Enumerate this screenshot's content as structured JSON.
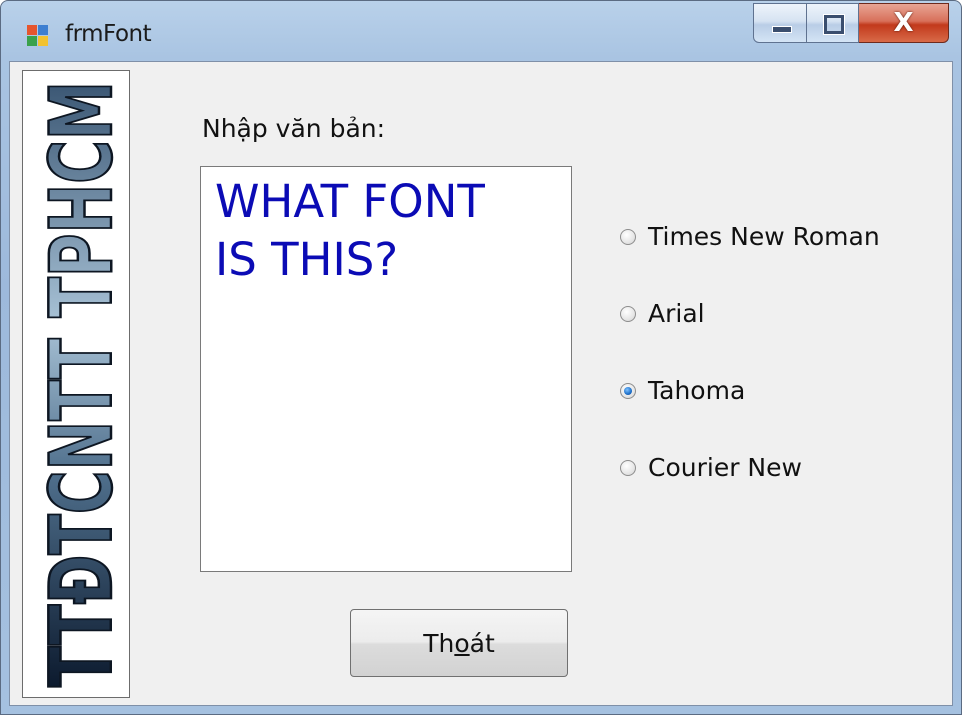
{
  "window": {
    "title": "frmFont"
  },
  "title_controls": {
    "minimize_icon": "minimize-icon",
    "maximize_icon": "maximize-icon",
    "close_icon": "close-icon",
    "close_glyph": "X"
  },
  "logo": {
    "text": "TTĐTCNTT TPHCM"
  },
  "form": {
    "prompt_label": "Nhập văn bản:",
    "text_value": "WHAT FONT\nIS THIS?",
    "text_color": "#0b0bb5"
  },
  "font_options": [
    {
      "label": "Times New Roman",
      "checked": false
    },
    {
      "label": "Arial",
      "checked": false
    },
    {
      "label": "Tahoma",
      "checked": true
    },
    {
      "label": "Courier New",
      "checked": false
    }
  ],
  "exit_button": {
    "pre": "Th",
    "accel": "o",
    "post": "át"
  }
}
